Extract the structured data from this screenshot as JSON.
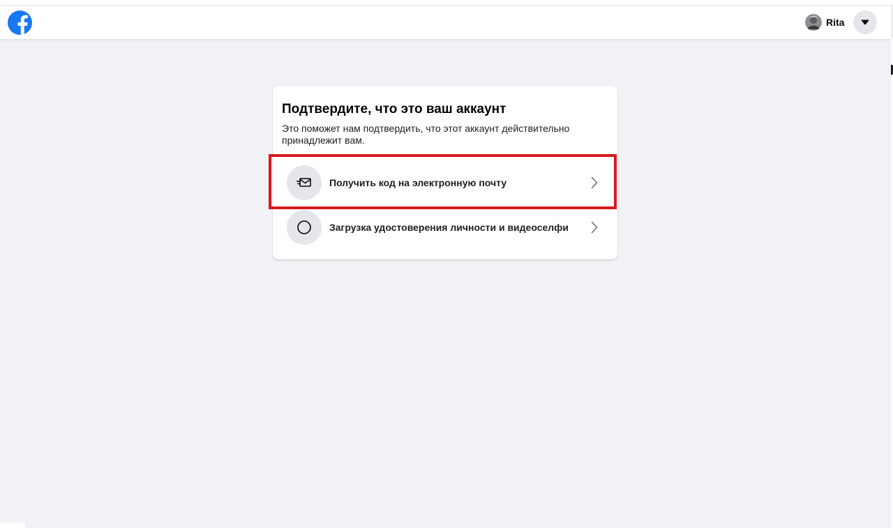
{
  "header": {
    "logo_icon": "facebook-logo-icon",
    "profile_name": "Rita",
    "menu_icon": "caret-down-icon",
    "brand_color": "#1877f2"
  },
  "card": {
    "title": "Подтвердите, что это ваш аккаунт",
    "description": "Это поможет нам подтвердить, что этот аккаунт действительно принадлежит вам.",
    "options": [
      {
        "label": "Получить код на электронную почту",
        "icon": "email-send-icon",
        "chevron_icon": "chevron-right-icon",
        "highlighted": true
      },
      {
        "label": "Загрузка удостоверения личности и видеоселфи",
        "icon": "circle-icon",
        "chevron_icon": "chevron-right-icon",
        "highlighted": false
      }
    ]
  },
  "annotation": {
    "highlight_color": "#d71921"
  }
}
